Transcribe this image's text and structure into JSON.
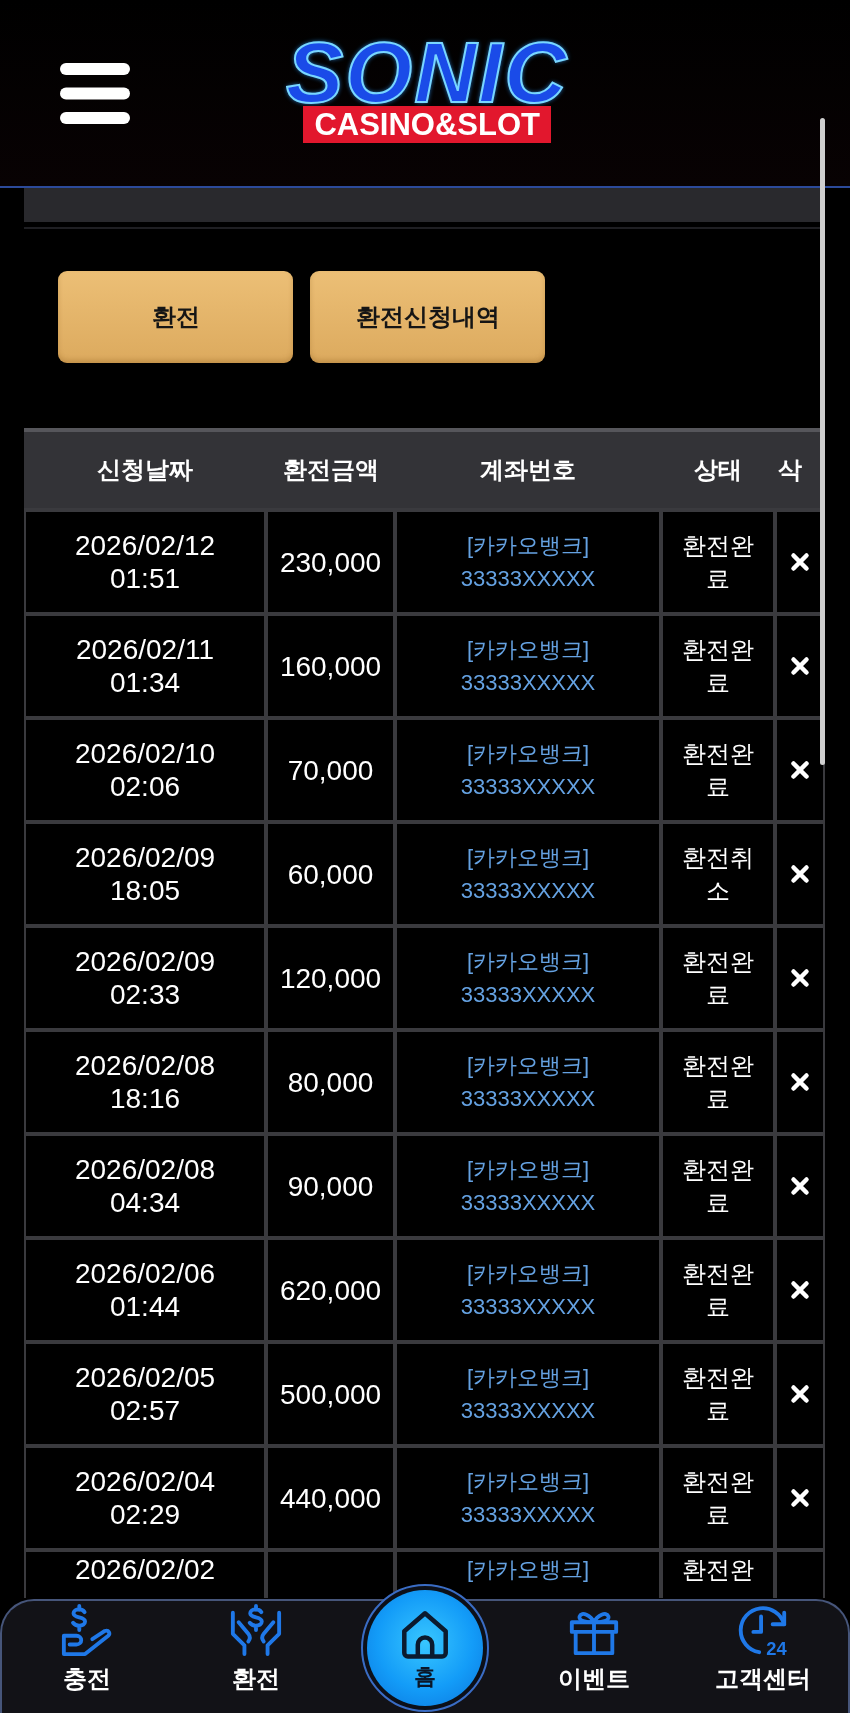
{
  "header": {
    "logo": {
      "title": "SONIC",
      "subtitle": "CASINO&SLOT"
    }
  },
  "actions": [
    {
      "label": "환전"
    },
    {
      "label": "환전신청내역"
    }
  ],
  "table": {
    "columns": [
      "신청날짜",
      "환전금액",
      "계좌번호",
      "상태",
      "삭"
    ],
    "rows": [
      {
        "date": "2026/02/12",
        "time": "01:51",
        "amount": "230,000",
        "bank": "[카카오뱅크]",
        "account": "33333XXXXX",
        "status": "환전완료"
      },
      {
        "date": "2026/02/11",
        "time": "01:34",
        "amount": "160,000",
        "bank": "[카카오뱅크]",
        "account": "33333XXXXX",
        "status": "환전완료"
      },
      {
        "date": "2026/02/10",
        "time": "02:06",
        "amount": "70,000",
        "bank": "[카카오뱅크]",
        "account": "33333XXXXX",
        "status": "환전완료"
      },
      {
        "date": "2026/02/09",
        "time": "18:05",
        "amount": "60,000",
        "bank": "[카카오뱅크]",
        "account": "33333XXXXX",
        "status": "환전취소"
      },
      {
        "date": "2026/02/09",
        "time": "02:33",
        "amount": "120,000",
        "bank": "[카카오뱅크]",
        "account": "33333XXXXX",
        "status": "환전완료"
      },
      {
        "date": "2026/02/08",
        "time": "18:16",
        "amount": "80,000",
        "bank": "[카카오뱅크]",
        "account": "33333XXXXX",
        "status": "환전완료"
      },
      {
        "date": "2026/02/08",
        "time": "04:34",
        "amount": "90,000",
        "bank": "[카카오뱅크]",
        "account": "33333XXXXX",
        "status": "환전완료"
      },
      {
        "date": "2026/02/06",
        "time": "01:44",
        "amount": "620,000",
        "bank": "[카카오뱅크]",
        "account": "33333XXXXX",
        "status": "환전완료"
      },
      {
        "date": "2026/02/05",
        "time": "02:57",
        "amount": "500,000",
        "bank": "[카카오뱅크]",
        "account": "33333XXXXX",
        "status": "환전완료"
      },
      {
        "date": "2026/02/04",
        "time": "02:29",
        "amount": "440,000",
        "bank": "[카카오뱅크]",
        "account": "33333XXXXX",
        "status": "환전완료"
      }
    ],
    "cut_row": {
      "date": "2026/02/02",
      "bank": "[카카오뱅크]",
      "status": "환전완"
    }
  },
  "bottom_nav": [
    {
      "kind": "tab",
      "label": "충전"
    },
    {
      "kind": "tab",
      "label": "환전"
    },
    {
      "kind": "center",
      "label": "홈"
    },
    {
      "kind": "tab",
      "label": "이벤트"
    },
    {
      "kind": "tab",
      "label": "고객센터",
      "icon_text": "24"
    }
  ]
}
